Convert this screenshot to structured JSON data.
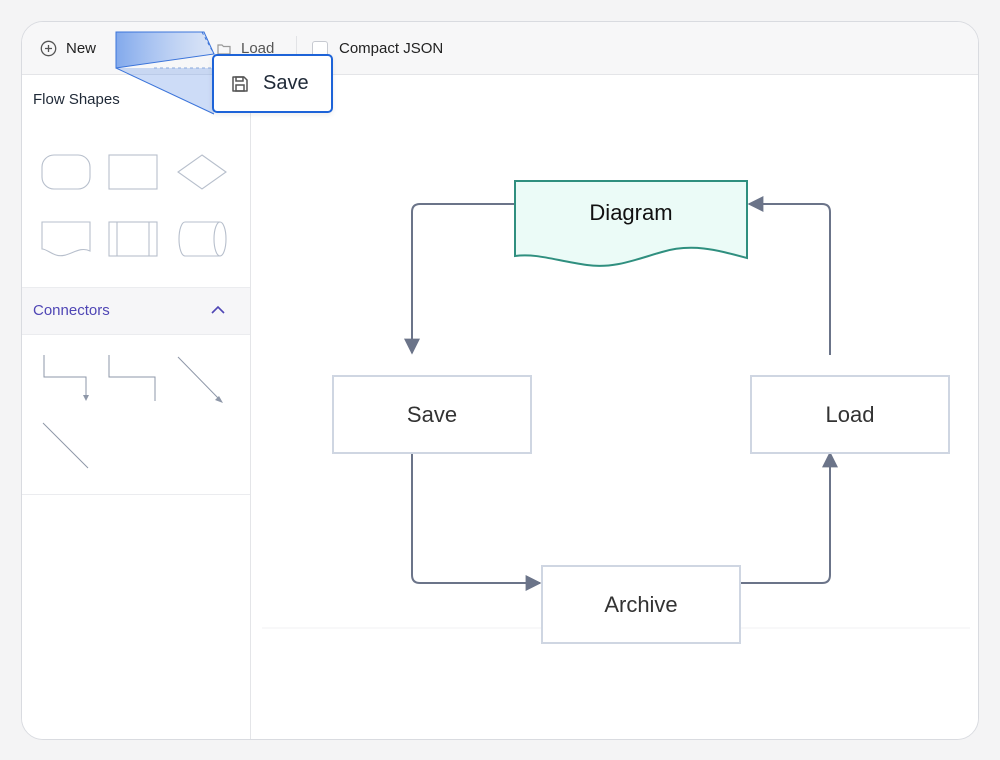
{
  "toolbar": {
    "new_label": "New",
    "load_label": "Load",
    "compact_label": "Compact JSON",
    "compact_checked": false
  },
  "sidebar": {
    "flow_shapes_title": "Flow Shapes",
    "connectors_title": "Connectors",
    "flow_shapes": [
      "terminator",
      "process",
      "decision",
      "document",
      "predefined-process",
      "direct-data"
    ],
    "connectors": [
      "orthogonal-arrow",
      "orthogonal-line",
      "straight-arrow",
      "straight-line"
    ]
  },
  "diagram": {
    "nodes": {
      "diagram": "Diagram",
      "save": "Save",
      "load": "Load",
      "archive": "Archive"
    },
    "colors": {
      "document_fill": "#ebfbf7",
      "document_stroke": "#2f8f7f",
      "node_stroke": "#cfd6e2",
      "connector": "#6b7489"
    }
  },
  "drag_tooltip": {
    "label": "Save",
    "icon": "save-icon",
    "accent": "#1d63d8"
  }
}
